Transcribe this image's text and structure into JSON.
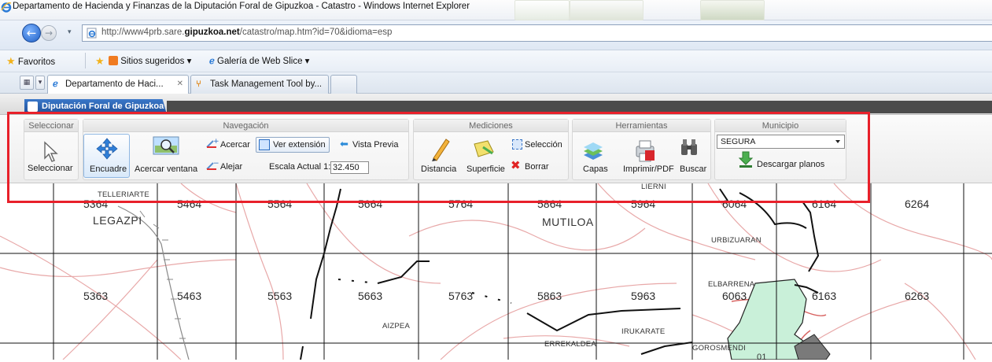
{
  "window": {
    "title": "Departamento de Hacienda y Finanzas de la Diputación Foral de Gipuzkoa - Catastro - Windows Internet Explorer"
  },
  "address_bar": {
    "url_prefix": "http://www4prb.sare.",
    "url_domain": "gipuzkoa.net",
    "url_suffix": "/catastro/map.htm?id=70&idioma=esp"
  },
  "favorites_bar": {
    "favorites": "Favoritos",
    "suggested_sites": "Sitios sugeridos ▾",
    "web_slice": "Galería de Web Slice ▾"
  },
  "tabs": [
    {
      "label": "Departamento de Haci...",
      "close": "✕"
    },
    {
      "label": "Task Management Tool by..."
    }
  ],
  "app": {
    "header_tab": "Diputación Foral de Gipuzkoa"
  },
  "ribbon": {
    "groups": {
      "select": "Seleccionar",
      "navigation": "Navegación",
      "measurements": "Mediciones",
      "tools": "Herramientas",
      "municipality": "Municipio"
    },
    "select_label": "Seleccionar",
    "nav": {
      "pan": "Encuadre",
      "zoom_window": "Acercar ventana",
      "zoom_in": "Acercar",
      "zoom_out": "Alejar",
      "full_extent": "Ver extensión",
      "prev_view": "Vista Previa",
      "scale_label": "Escala Actual 1:",
      "scale_value": "32.450"
    },
    "measure": {
      "distance": "Distancia",
      "area": "Superficie",
      "selection": "Selección",
      "clear": "Borrar"
    },
    "tools": {
      "layers": "Capas",
      "print": "Imprimir/PDF",
      "search": "Buscar"
    },
    "municipality": {
      "selected": "SEGURA",
      "download": "Descargar planos"
    }
  },
  "map": {
    "cells_row1": [
      "5364",
      "5464",
      "5564",
      "5664",
      "5764",
      "5864",
      "5964",
      "6064",
      "6164",
      "6264"
    ],
    "cells_row2": [
      "5363",
      "5463",
      "5563",
      "5663",
      "5763",
      "5863",
      "5963",
      "6063",
      "6163",
      "6263"
    ],
    "places": {
      "telleriarte": "TELLERIARTE",
      "legazpi": "LEGAZPI",
      "mutiloa": "MUTILOA",
      "lierni": "LIERNI",
      "urbizuaran": "URBIZUARAN",
      "elbarrena": "ELBARRENA",
      "aizpea": "AIZPEA",
      "irukarate": "IRUKARATE",
      "errekaldea": "ERREKALDEA",
      "gorosmendi": "GOROSMENDI"
    },
    "parcel_label": "01"
  },
  "colors": {
    "highlight": "#e8202a",
    "app_tab": "#2a5fae",
    "roads": "#e8a8a8",
    "parcel_fill": "#c9f0d9"
  }
}
